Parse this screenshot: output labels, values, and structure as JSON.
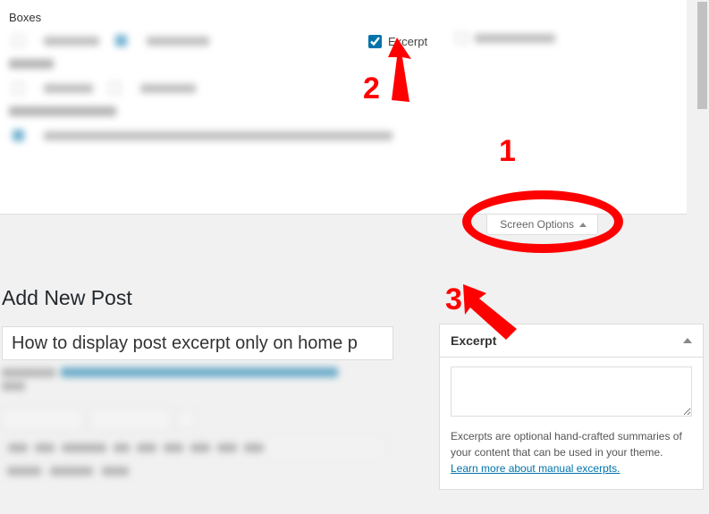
{
  "boxes_panel": {
    "title": "Boxes",
    "excerpt_checkbox_label": "Excerpt"
  },
  "screen_options": {
    "label": "Screen Options"
  },
  "editor": {
    "page_title": "Add New Post",
    "title_value": "How to display post excerpt only on home p"
  },
  "excerpt_metabox": {
    "heading": "Excerpt",
    "textarea_value": "",
    "help_text": "Excerpts are optional hand-crafted summaries of your content that can be used in your theme. ",
    "help_link_text": "Learn more about manual excerpts."
  },
  "annotations": {
    "n1": "1",
    "n2": "2",
    "n3": "3"
  }
}
